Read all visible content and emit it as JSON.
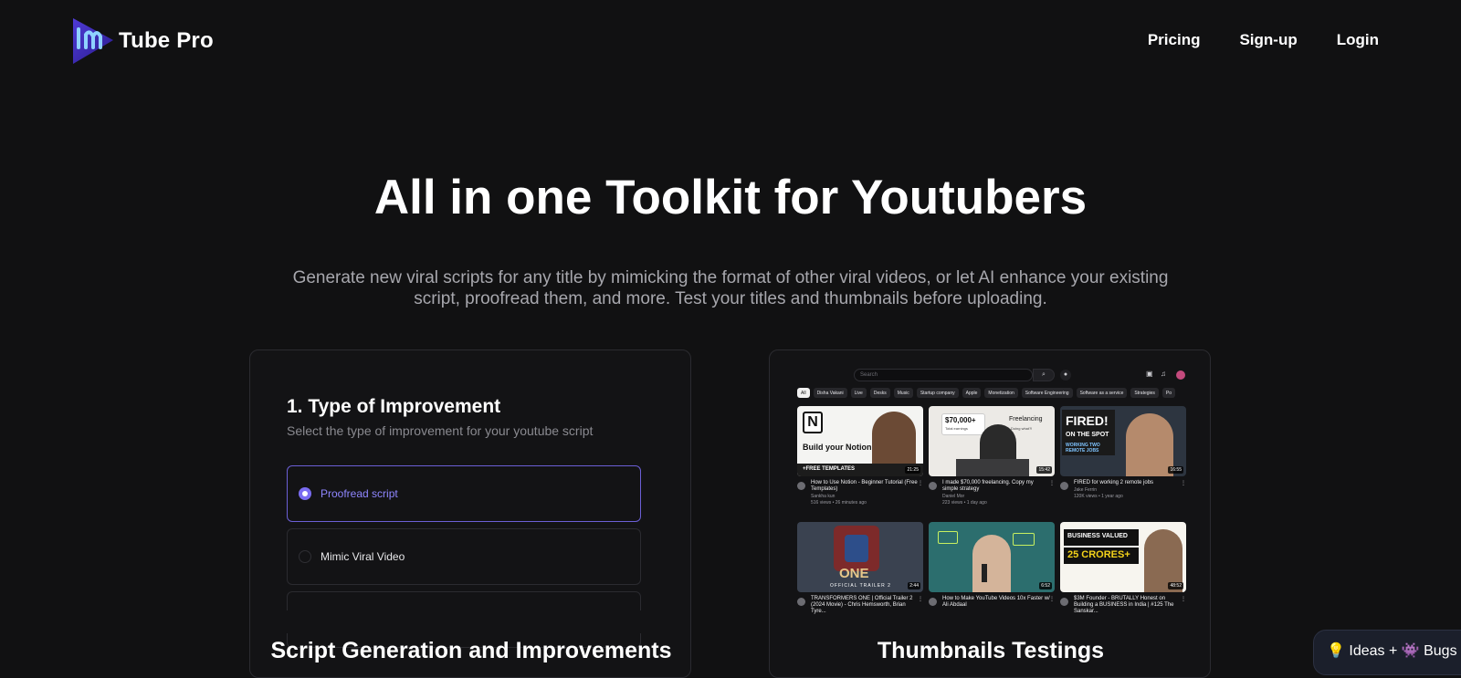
{
  "brand": {
    "name": "Tube Pro",
    "logo_icon": "tube-pro-logo-icon"
  },
  "nav": {
    "pricing": "Pricing",
    "signup": "Sign-up",
    "login": "Login"
  },
  "hero": {
    "title": "All in one Toolkit for Youtubers",
    "subtitle_line1": "Generate new viral scripts for any title by mimicking the format of other viral videos, or let AI enhance your existing",
    "subtitle_line2": "script, proofread them, and more. Test your titles and thumbnails before uploading."
  },
  "script_card": {
    "step_title": "1. Type of Improvement",
    "step_desc": "Select the type of improvement for your youtube script",
    "options": [
      {
        "label": "Proofread script",
        "selected": true
      },
      {
        "label": "Mimic Viral Video",
        "selected": false
      },
      {
        "label": "",
        "selected": false
      }
    ],
    "caption": "Script Generation and Improvements"
  },
  "thumb_card": {
    "caption": "Thumbnails Testings",
    "search_placeholder": "Search",
    "chips": [
      "All",
      "Disha Vakani",
      "Live",
      "Desks",
      "Music",
      "Startup company",
      "Apple",
      "Monetization",
      "Software Engineering",
      "Software as a service",
      "Strategies",
      "Po"
    ],
    "videos": [
      {
        "title": "How to Use Notion - Beginner Tutorial (Free Templates)",
        "channel": "Sankha kun",
        "meta": "516 views • 26 minutes ago",
        "duration": "21:25",
        "thumb_text1": "Build your Notion.",
        "thumb_text2": "+FREE TEMPLATES"
      },
      {
        "title": "I made $70,000 freelancing. Copy my simple strategy",
        "channel": "Daniel Mor",
        "meta": "223 views • 1 day ago",
        "duration": "15:42",
        "thumb_text1": "$70,000+",
        "thumb_text2": "Total earnings",
        "thumb_text3": "Freelancing",
        "thumb_text4": "Doing what?!"
      },
      {
        "title": "FIRED for working 2 remote jobs",
        "channel": "Jake Ferrin",
        "meta": "120K views • 1 year ago",
        "duration": "16:55",
        "thumb_text1": "FIRED!",
        "thumb_text2": "ON THE SPOT",
        "thumb_text3": "WORKING TWO REMOTE JOBS"
      },
      {
        "title": "TRANSFORMERS ONE | Official Trailer 2 (2024 Movie) - Chris Hemsworth, Brian Tyre...",
        "channel": "",
        "meta": "",
        "duration": "2:44",
        "thumb_text1": "ONE",
        "thumb_text2": "OFFICIAL TRAILER 2"
      },
      {
        "title": "How to Make YouTube Videos 10x Faster w/ Ali Abdaal",
        "channel": "",
        "meta": "",
        "duration": "6:52",
        "thumb_text1": "",
        "thumb_text2": ""
      },
      {
        "title": "$3M Founder - BRUTALLY Honest on Building a BUSINESS in India | #125 The Sanskar...",
        "channel": "",
        "meta": "",
        "duration": "48:52",
        "thumb_text1": "BUSINESS VALUED",
        "thumb_text2": "25 CRORES+"
      }
    ]
  },
  "feedback": {
    "label": "💡 Ideas + 👾 Bugs"
  }
}
